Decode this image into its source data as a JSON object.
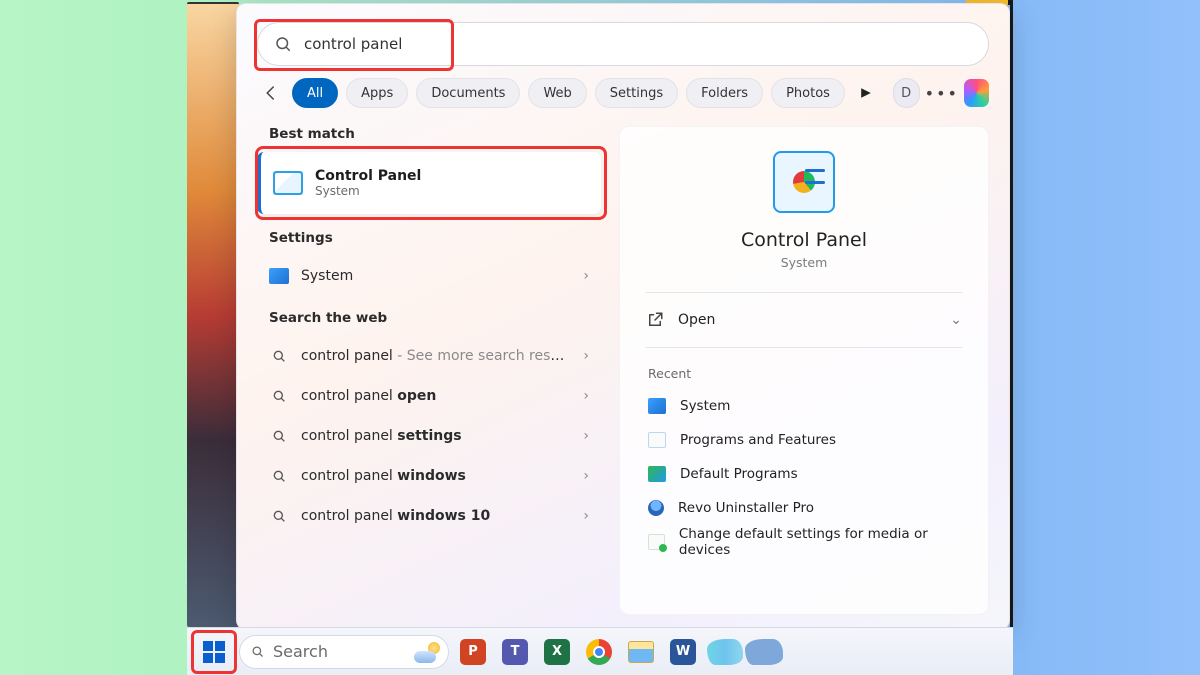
{
  "search": {
    "query": "control panel"
  },
  "filters": {
    "items": [
      "All",
      "Apps",
      "Documents",
      "Web",
      "Settings",
      "Folders",
      "Photos"
    ],
    "avatar_initial": "D"
  },
  "left": {
    "best_match_label": "Best match",
    "best_match": {
      "title": "Control Panel",
      "subtitle": "System"
    },
    "settings_label": "Settings",
    "settings_item": "System",
    "search_web_label": "Search the web",
    "web": [
      {
        "pre": "control panel",
        "post": "",
        "tail": " - See more search results"
      },
      {
        "pre": "control panel ",
        "post": "open",
        "tail": ""
      },
      {
        "pre": "control panel ",
        "post": "settings",
        "tail": ""
      },
      {
        "pre": "control panel ",
        "post": "windows",
        "tail": ""
      },
      {
        "pre": "control panel ",
        "post": "windows 10",
        "tail": ""
      }
    ]
  },
  "right": {
    "title": "Control Panel",
    "subtitle": "System",
    "open_label": "Open",
    "recent_label": "Recent",
    "recent": [
      "System",
      "Programs and Features",
      "Default Programs",
      "Revo Uninstaller Pro",
      "Change default settings for media or devices"
    ]
  },
  "taskbar": {
    "search_placeholder": "Search",
    "apps": {
      "ppt": "P",
      "teams": "T",
      "xls": "X",
      "word": "W"
    }
  }
}
